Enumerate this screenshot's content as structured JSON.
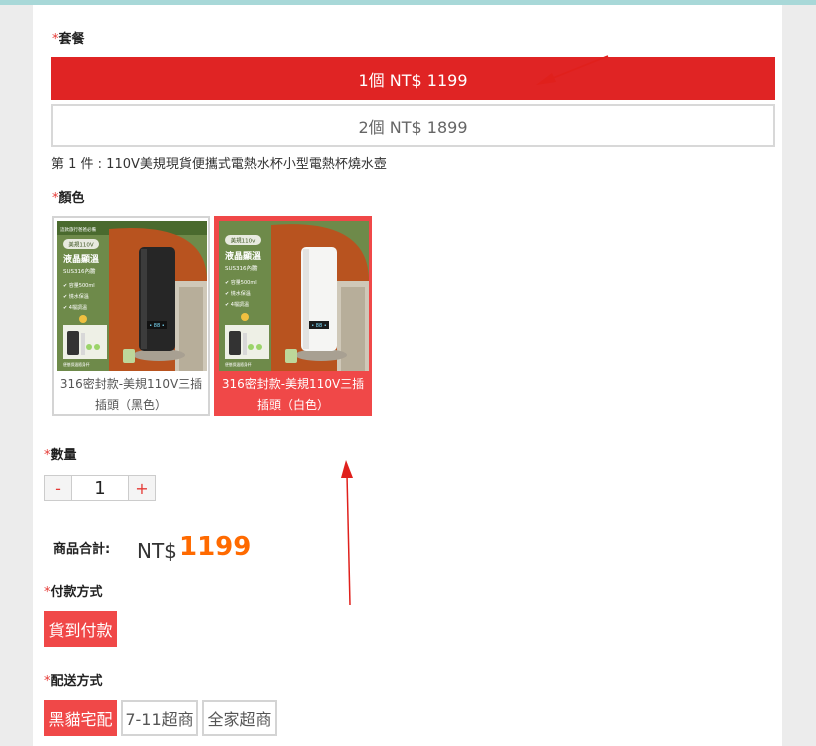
{
  "package": {
    "label": "套餐",
    "required_mark": "*",
    "options": [
      {
        "label": "1個 NT$ 1199",
        "selected": true
      },
      {
        "label": "2個 NT$ 1899",
        "selected": false
      }
    ],
    "description": "第 1 件 : 110V美規現貨便攜式電熱水杯小型電熱杯燒水壺"
  },
  "color": {
    "label": "顏色",
    "required_mark": "*",
    "options": [
      {
        "caption": "316密封款-美規110V三插插頭（黑色）",
        "selected": false,
        "product_image_text": {
          "top": "這款旅行爸爸必備",
          "badge": "美規110V",
          "title": "液晶顯溫",
          "sub": "SUS316內膽",
          "features": [
            "容量500ml",
            "燒水保溫",
            "4檔調溫"
          ],
          "bottom": "便攜保溫隨身杯"
        }
      },
      {
        "caption": "316密封款-美規110V三插插頭（白色）",
        "selected": true,
        "product_image_text": {
          "badge": "美規110v",
          "title": "液晶顯溫",
          "sub": "SUS316內膽",
          "features": [
            "容量500ml",
            "燒水保溫",
            "4檔調溫"
          ],
          "bottom": "便攜保溫隨身杯"
        }
      }
    ]
  },
  "quantity": {
    "label": "數量",
    "required_mark": "*",
    "minus": "-",
    "value": "1",
    "plus": "+"
  },
  "total": {
    "label": "商品合計:",
    "currency": "NT$",
    "amount": "1199"
  },
  "payment": {
    "label": "付款方式",
    "required_mark": "*",
    "options": [
      {
        "label": "貨到付款",
        "selected": true
      }
    ]
  },
  "shipping": {
    "label": "配送方式",
    "required_mark": "*",
    "options": [
      {
        "label": "黑貓宅配",
        "selected": true
      },
      {
        "label": "7-11超商",
        "selected": false
      },
      {
        "label": "全家超商",
        "selected": false
      }
    ]
  },
  "colors": {
    "primary_red": "#e02424",
    "price_orange": "#ff6a00",
    "annotation_red": "#e0201c"
  }
}
